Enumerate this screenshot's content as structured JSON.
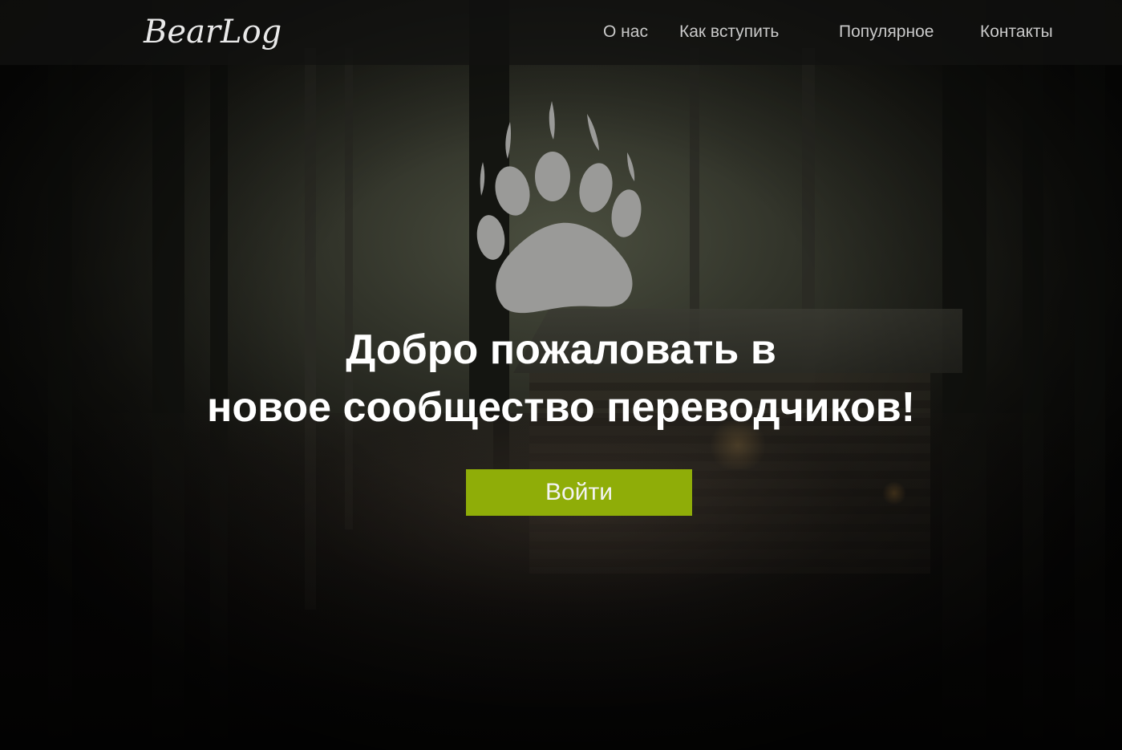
{
  "header": {
    "logo_text": "BearLog",
    "nav": [
      {
        "label": "О нас"
      },
      {
        "label": "Как вступить"
      },
      {
        "label": "Популярное"
      },
      {
        "label": "Контакты"
      }
    ]
  },
  "hero": {
    "icon": "bear-paw-icon",
    "headline_line1": "Добро пожаловать в",
    "headline_line2": "новое сообщество переводчиков!",
    "login_label": "Войти"
  },
  "colors": {
    "accent": "#8fad08",
    "header_bg": "#121210",
    "paw": "#9a9a98",
    "text": "#ffffff",
    "nav_text": "#c9c9c9"
  }
}
